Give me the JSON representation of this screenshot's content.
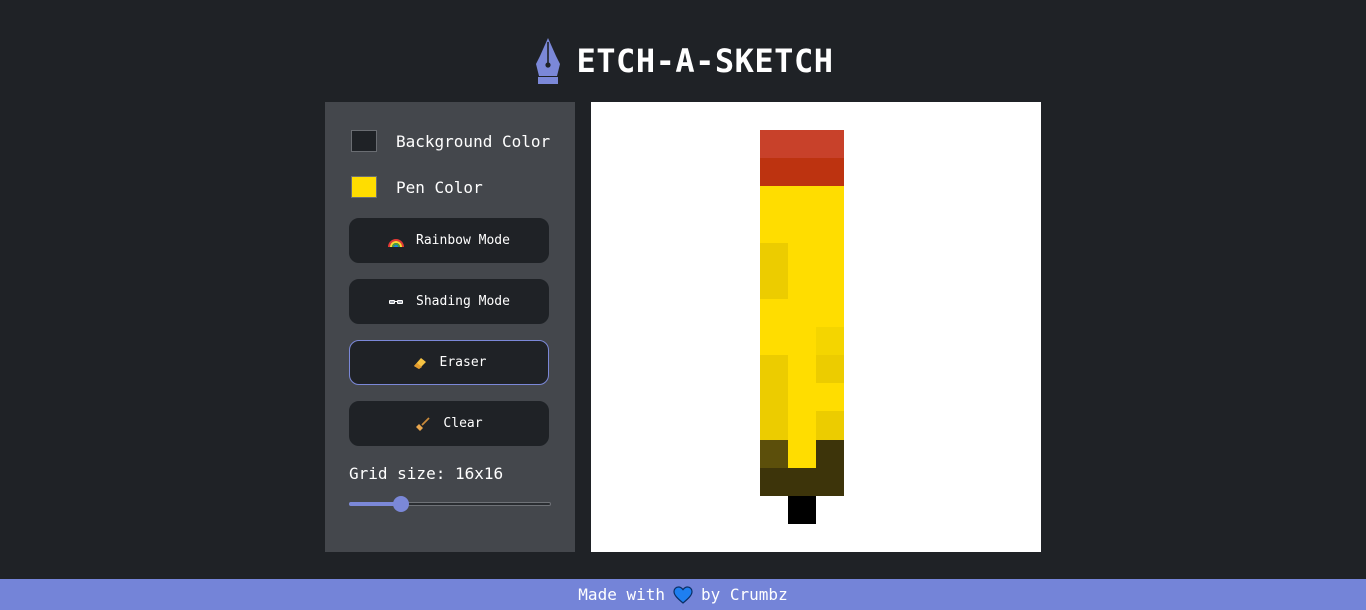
{
  "app": {
    "title": "ETCH-A-SKETCH",
    "logo_icon": "fountain-pen-nib-icon",
    "accent_color": "#7b88d8"
  },
  "controls": {
    "background_color": {
      "label": "Background Color",
      "value": "#1f2226"
    },
    "pen_color": {
      "label": "Pen Color",
      "value": "#ffdd00"
    },
    "buttons": [
      {
        "id": "rainbow",
        "label": "Rainbow Mode",
        "icon": "rainbow-icon",
        "active": false
      },
      {
        "id": "shading",
        "label": "Shading Mode",
        "icon": "sunglasses-icon",
        "active": false
      },
      {
        "id": "eraser",
        "label": "Eraser",
        "icon": "eraser-icon",
        "active": true
      },
      {
        "id": "clear",
        "label": "Clear",
        "icon": "broom-icon",
        "active": false
      }
    ],
    "grid_size": {
      "label": "Grid size: 16x16",
      "value": 16,
      "min": 1,
      "max": 64
    }
  },
  "canvas": {
    "grid": 16,
    "default_color": "#ffffff",
    "painted_cells": [
      {
        "row": 1,
        "cols": [
          6,
          7,
          8
        ],
        "color": "#c8412a"
      },
      {
        "row": 2,
        "cols": [
          6,
          7,
          8
        ],
        "color": "#bd3310"
      },
      {
        "row": 3,
        "cols": [
          6,
          7,
          8
        ],
        "color": "#ffdd00"
      },
      {
        "row": 4,
        "cols": [
          6,
          7,
          8
        ],
        "color": "#ffdd00"
      },
      {
        "row": 5,
        "cols": [
          6
        ],
        "color": "#eccc00"
      },
      {
        "row": 5,
        "cols": [
          7,
          8
        ],
        "color": "#ffdd00"
      },
      {
        "row": 6,
        "cols": [
          6
        ],
        "color": "#eccc00"
      },
      {
        "row": 6,
        "cols": [
          7,
          8
        ],
        "color": "#ffdd00"
      },
      {
        "row": 7,
        "cols": [
          6,
          7,
          8
        ],
        "color": "#ffdd00"
      },
      {
        "row": 8,
        "cols": [
          6,
          7
        ],
        "color": "#ffdd00"
      },
      {
        "row": 8,
        "cols": [
          8
        ],
        "color": "#f4d500"
      },
      {
        "row": 9,
        "cols": [
          6
        ],
        "color": "#eccc00"
      },
      {
        "row": 9,
        "cols": [
          7
        ],
        "color": "#ffdd00"
      },
      {
        "row": 9,
        "cols": [
          8
        ],
        "color": "#eccc00"
      },
      {
        "row": 10,
        "cols": [
          6
        ],
        "color": "#eccc00"
      },
      {
        "row": 10,
        "cols": [
          7,
          8
        ],
        "color": "#ffdd00"
      },
      {
        "row": 11,
        "cols": [
          6
        ],
        "color": "#eccc00"
      },
      {
        "row": 11,
        "cols": [
          7
        ],
        "color": "#ffdd00"
      },
      {
        "row": 11,
        "cols": [
          8
        ],
        "color": "#eccc00"
      },
      {
        "row": 12,
        "cols": [
          6
        ],
        "color": "#5c4f0b"
      },
      {
        "row": 12,
        "cols": [
          7
        ],
        "color": "#ffdd00"
      },
      {
        "row": 12,
        "cols": [
          8
        ],
        "color": "#3d340a"
      },
      {
        "row": 13,
        "cols": [
          6,
          7,
          8
        ],
        "color": "#3d340a"
      },
      {
        "row": 14,
        "cols": [
          7
        ],
        "color": "#000000"
      }
    ]
  },
  "footer": {
    "text_before": "Made with",
    "heart_icon": "blue-heart-icon",
    "text_after": "by  Crumbz"
  }
}
